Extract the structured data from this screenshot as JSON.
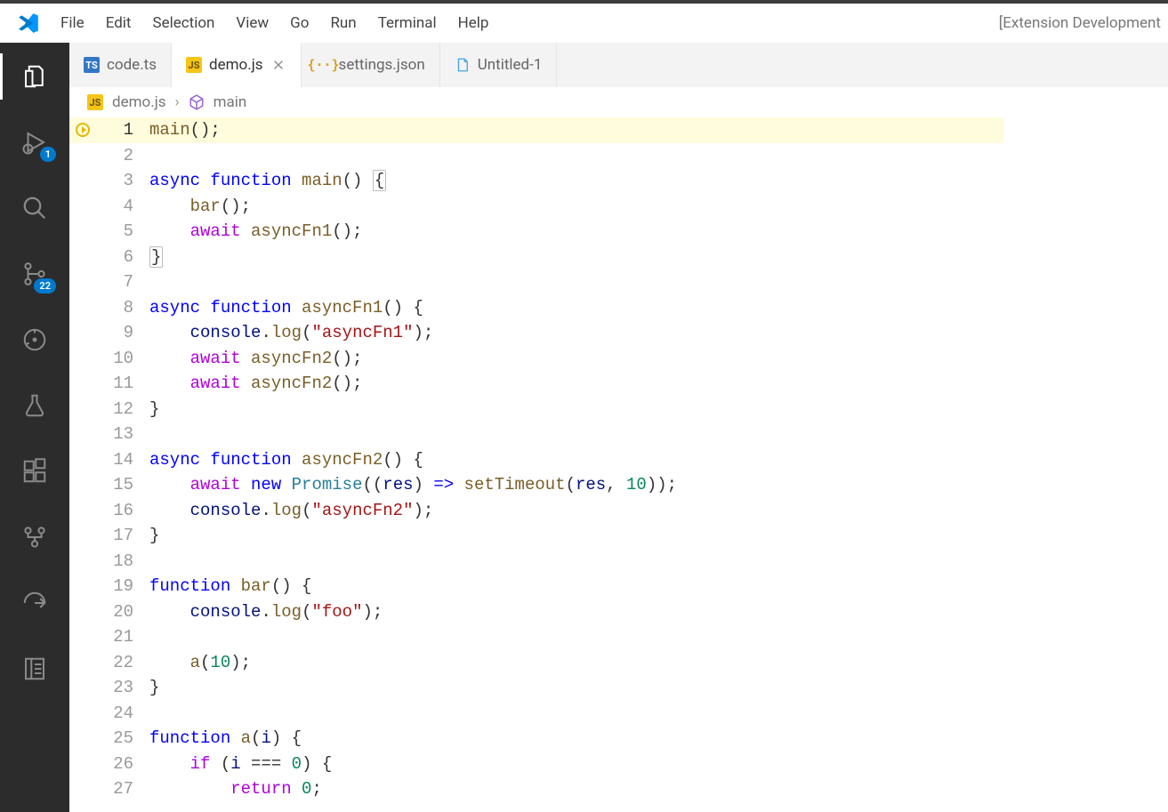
{
  "title_right": "[Extension Development",
  "menu": [
    "File",
    "Edit",
    "Selection",
    "View",
    "Go",
    "Run",
    "Terminal",
    "Help"
  ],
  "activity": {
    "items": [
      {
        "name": "explorer-icon",
        "active": true,
        "badge": null
      },
      {
        "name": "run-debug-icon",
        "active": false,
        "badge": "1"
      },
      {
        "name": "search-icon",
        "active": false,
        "badge": null
      },
      {
        "name": "source-control-icon",
        "active": false,
        "badge": "22"
      },
      {
        "name": "timeline-icon",
        "active": false,
        "badge": null
      },
      {
        "name": "testing-icon",
        "active": false,
        "badge": null
      },
      {
        "name": "extensions-icon",
        "active": false,
        "badge": null
      },
      {
        "name": "git-graph-icon",
        "active": false,
        "badge": null
      },
      {
        "name": "send-icon",
        "active": false,
        "badge": null
      },
      {
        "name": "notes-icon",
        "active": false,
        "badge": null
      }
    ]
  },
  "tabs": [
    {
      "label": "code.ts",
      "icon": "ts",
      "active": false,
      "close": false
    },
    {
      "label": "demo.js",
      "icon": "js",
      "active": true,
      "close": true
    },
    {
      "label": "settings.json",
      "icon": "json",
      "active": false,
      "close": false
    },
    {
      "label": "Untitled-1",
      "icon": "file",
      "active": false,
      "close": false
    }
  ],
  "breadcrumb": {
    "file": "demo.js",
    "symbol": "main"
  },
  "editor": {
    "highlighted_line": 1,
    "lines": [
      {
        "n": 1,
        "bp": true,
        "tokens": [
          [
            "call",
            "main"
          ],
          [
            "pun",
            "();"
          ]
        ]
      },
      {
        "n": 2,
        "tokens": []
      },
      {
        "n": 3,
        "tokens": [
          [
            "kw",
            "async"
          ],
          [
            "pun",
            " "
          ],
          [
            "kw",
            "function"
          ],
          [
            "pun",
            " "
          ],
          [
            "fn",
            "main"
          ],
          [
            "pun",
            "() "
          ],
          [
            "boxpun",
            "{"
          ]
        ]
      },
      {
        "n": 4,
        "indent": 1,
        "tokens": [
          [
            "pun",
            "    "
          ],
          [
            "call",
            "bar"
          ],
          [
            "pun",
            "();"
          ]
        ]
      },
      {
        "n": 5,
        "indent": 1,
        "tokens": [
          [
            "pun",
            "    "
          ],
          [
            "kw2",
            "await"
          ],
          [
            "pun",
            " "
          ],
          [
            "call",
            "asyncFn1"
          ],
          [
            "pun",
            "();"
          ]
        ]
      },
      {
        "n": 6,
        "tokens": [
          [
            "boxpun",
            "}"
          ]
        ]
      },
      {
        "n": 7,
        "tokens": []
      },
      {
        "n": 8,
        "tokens": [
          [
            "kw",
            "async"
          ],
          [
            "pun",
            " "
          ],
          [
            "kw",
            "function"
          ],
          [
            "pun",
            " "
          ],
          [
            "fn",
            "asyncFn1"
          ],
          [
            "pun",
            "() {"
          ]
        ]
      },
      {
        "n": 9,
        "indent": 1,
        "tokens": [
          [
            "pun",
            "    "
          ],
          [
            "var",
            "console"
          ],
          [
            "pun",
            "."
          ],
          [
            "call",
            "log"
          ],
          [
            "pun",
            "("
          ],
          [
            "str",
            "\"asyncFn1\""
          ],
          [
            "pun",
            ");"
          ]
        ]
      },
      {
        "n": 10,
        "indent": 1,
        "tokens": [
          [
            "pun",
            "    "
          ],
          [
            "kw2",
            "await"
          ],
          [
            "pun",
            " "
          ],
          [
            "call",
            "asyncFn2"
          ],
          [
            "pun",
            "();"
          ]
        ]
      },
      {
        "n": 11,
        "indent": 1,
        "tokens": [
          [
            "pun",
            "    "
          ],
          [
            "kw2",
            "await"
          ],
          [
            "pun",
            " "
          ],
          [
            "call",
            "asyncFn2"
          ],
          [
            "pun",
            "();"
          ]
        ]
      },
      {
        "n": 12,
        "tokens": [
          [
            "pun",
            "}"
          ]
        ]
      },
      {
        "n": 13,
        "tokens": []
      },
      {
        "n": 14,
        "tokens": [
          [
            "kw",
            "async"
          ],
          [
            "pun",
            " "
          ],
          [
            "kw",
            "function"
          ],
          [
            "pun",
            " "
          ],
          [
            "fn",
            "asyncFn2"
          ],
          [
            "pun",
            "() {"
          ]
        ]
      },
      {
        "n": 15,
        "indent": 1,
        "tokens": [
          [
            "pun",
            "    "
          ],
          [
            "kw2",
            "await"
          ],
          [
            "pun",
            " "
          ],
          [
            "new",
            "new"
          ],
          [
            "pun",
            " "
          ],
          [
            "obj",
            "Promise"
          ],
          [
            "pun",
            "(("
          ],
          [
            "var",
            "res"
          ],
          [
            "pun",
            ") "
          ],
          [
            "kw",
            "=>"
          ],
          [
            "pun",
            " "
          ],
          [
            "call",
            "setTimeout"
          ],
          [
            "pun",
            "("
          ],
          [
            "var",
            "res"
          ],
          [
            "pun",
            ", "
          ],
          [
            "num",
            "10"
          ],
          [
            "pun",
            "));"
          ]
        ]
      },
      {
        "n": 16,
        "indent": 1,
        "tokens": [
          [
            "pun",
            "    "
          ],
          [
            "var",
            "console"
          ],
          [
            "pun",
            "."
          ],
          [
            "call",
            "log"
          ],
          [
            "pun",
            "("
          ],
          [
            "str",
            "\"asyncFn2\""
          ],
          [
            "pun",
            ");"
          ]
        ]
      },
      {
        "n": 17,
        "tokens": [
          [
            "pun",
            "}"
          ]
        ]
      },
      {
        "n": 18,
        "tokens": []
      },
      {
        "n": 19,
        "tokens": [
          [
            "kw",
            "function"
          ],
          [
            "pun",
            " "
          ],
          [
            "fn",
            "bar"
          ],
          [
            "pun",
            "() {"
          ]
        ]
      },
      {
        "n": 20,
        "indent": 1,
        "tokens": [
          [
            "pun",
            "    "
          ],
          [
            "var",
            "console"
          ],
          [
            "pun",
            "."
          ],
          [
            "call",
            "log"
          ],
          [
            "pun",
            "("
          ],
          [
            "str",
            "\"foo\""
          ],
          [
            "pun",
            ");"
          ]
        ]
      },
      {
        "n": 21,
        "indent": 1,
        "tokens": []
      },
      {
        "n": 22,
        "indent": 1,
        "tokens": [
          [
            "pun",
            "    "
          ],
          [
            "call",
            "a"
          ],
          [
            "pun",
            "("
          ],
          [
            "num",
            "10"
          ],
          [
            "pun",
            ");"
          ]
        ]
      },
      {
        "n": 23,
        "tokens": [
          [
            "pun",
            "}"
          ]
        ]
      },
      {
        "n": 24,
        "tokens": []
      },
      {
        "n": 25,
        "tokens": [
          [
            "kw",
            "function"
          ],
          [
            "pun",
            " "
          ],
          [
            "fn",
            "a"
          ],
          [
            "pun",
            "("
          ],
          [
            "var",
            "i"
          ],
          [
            "pun",
            ") {"
          ]
        ]
      },
      {
        "n": 26,
        "indent": 1,
        "tokens": [
          [
            "pun",
            "    "
          ],
          [
            "kw2",
            "if"
          ],
          [
            "pun",
            " ("
          ],
          [
            "var",
            "i"
          ],
          [
            "pun",
            " === "
          ],
          [
            "num",
            "0"
          ],
          [
            "pun",
            ") {"
          ]
        ]
      },
      {
        "n": 27,
        "indent": 2,
        "tokens": [
          [
            "pun",
            "        "
          ],
          [
            "kw2",
            "return"
          ],
          [
            "pun",
            " "
          ],
          [
            "num",
            "0"
          ],
          [
            "pun",
            ";"
          ]
        ]
      }
    ]
  }
}
